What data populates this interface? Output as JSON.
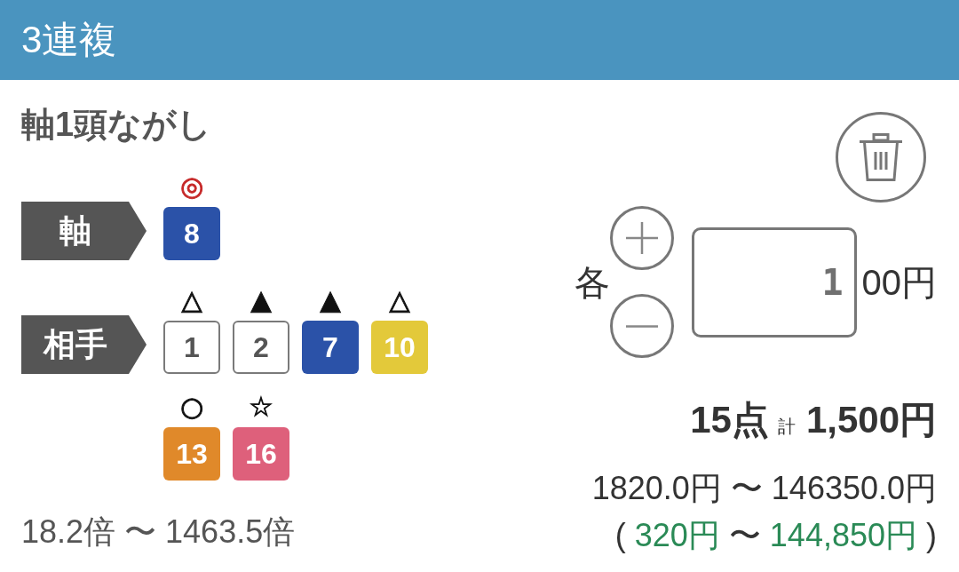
{
  "header": {
    "title": "3連複"
  },
  "bet": {
    "type_title": "軸1頭ながし",
    "groups": [
      {
        "label": "軸",
        "horses": [
          {
            "number": "8",
            "mark": {
              "symbol": "◎",
              "color": "#c62828"
            },
            "color": "#2b52a8"
          }
        ]
      },
      {
        "label": "相手",
        "horses": [
          {
            "number": "1",
            "mark": {
              "symbol": "△",
              "color": "#111111"
            },
            "color": "#ffffff"
          },
          {
            "number": "2",
            "mark": {
              "symbol": "▲",
              "color": "#111111"
            },
            "color": "#ffffff"
          },
          {
            "number": "7",
            "mark": {
              "symbol": "▲",
              "color": "#111111"
            },
            "color": "#2b52a8"
          },
          {
            "number": "10",
            "mark": {
              "symbol": "△",
              "color": "#111111"
            },
            "color": "#e3c93a"
          },
          {
            "number": "13",
            "mark": {
              "symbol": "○",
              "color": "#111111"
            },
            "color": "#e0892a"
          },
          {
            "number": "16",
            "mark": {
              "symbol": "☆",
              "color": "#111111"
            },
            "color": "#de607b"
          }
        ]
      }
    ],
    "odds_range": "18.2倍 〜 1463.5倍"
  },
  "stake": {
    "prefix": "各",
    "value": "1",
    "suffix": "00円"
  },
  "summary": {
    "points": "15点",
    "total_label": "計",
    "total": "1,500円",
    "payout_range": "1820.0円 〜 146350.0円",
    "profit_range": {
      "open": "(",
      "min": "320円",
      "separator": "〜",
      "max": "144,850円",
      "close": ")"
    }
  }
}
